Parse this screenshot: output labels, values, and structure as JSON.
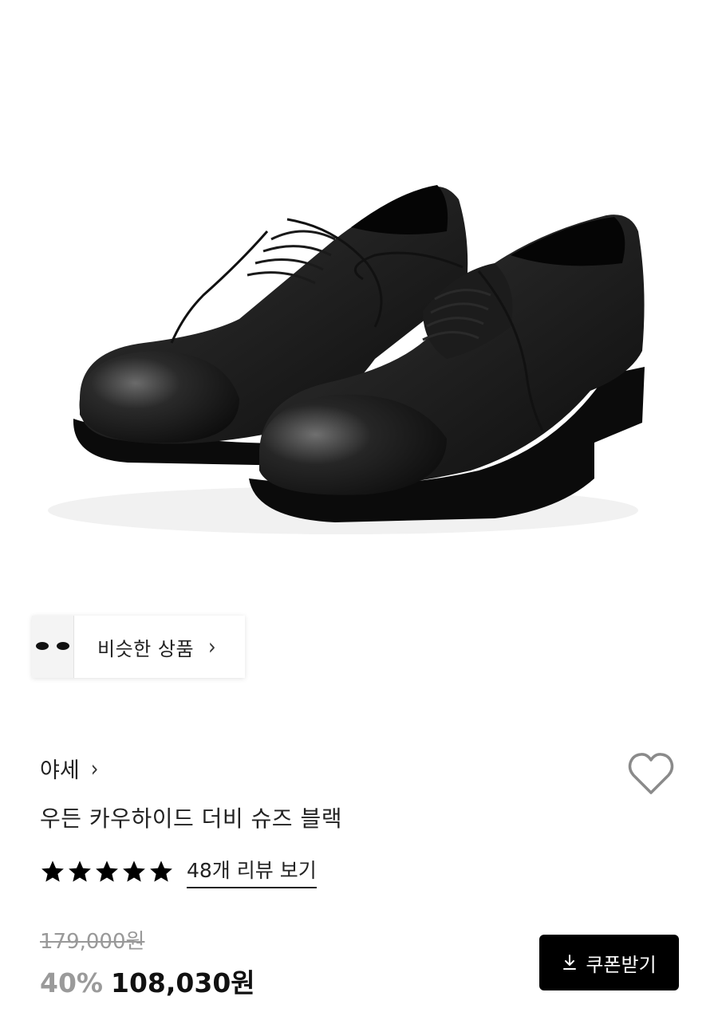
{
  "hero": {
    "image_alt": "black derby shoes"
  },
  "similar": {
    "label": "비슷한 상품",
    "chevron": "›"
  },
  "brand": {
    "name": "야세",
    "chevron": "›"
  },
  "product": {
    "title": "우든 카우하이드 더비 슈즈 블랙",
    "rating_stars": 5,
    "review_link": "48개 리뷰 보기"
  },
  "price": {
    "original": "179,000원",
    "discount": "40%",
    "sale": "108,030원"
  },
  "coupon": {
    "label": "쿠폰받기",
    "icon": "download-icon"
  },
  "icons": {
    "wishlist": "heart-icon",
    "star": "star-icon"
  },
  "colors": {
    "accent": "#000000",
    "muted": "#999999"
  }
}
